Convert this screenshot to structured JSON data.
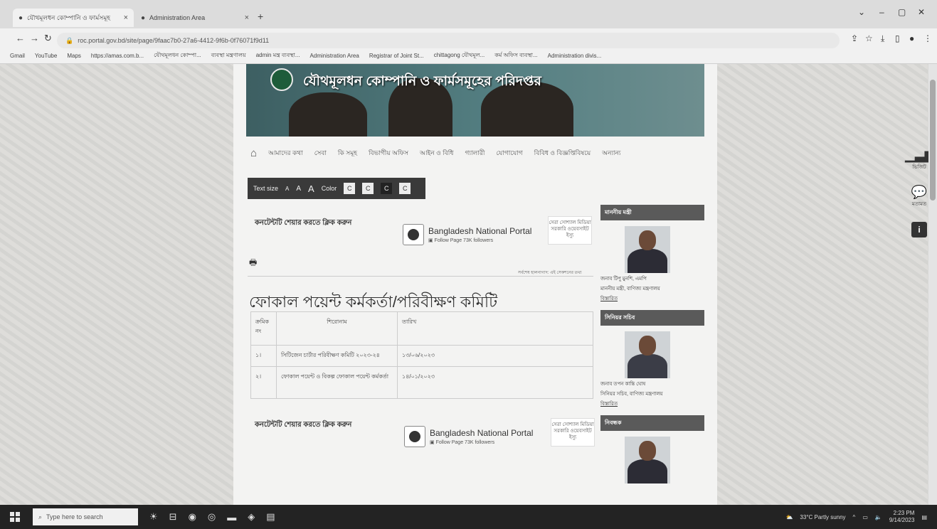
{
  "browser": {
    "tabs": [
      {
        "label": "যৌথমূলধন কোম্পানি ও ফার্মসমূহ",
        "active": true
      },
      {
        "label": "Administration Area",
        "active": false
      }
    ],
    "url": "roc.portal.gov.bd/site/page/9faac7b0-27a6-4412-9f6b-0f76071f9d11",
    "bookmarks": [
      "Gmail",
      "YouTube",
      "Maps",
      "https://amas.com.b...",
      "যৌথমূলধন কোম্পা...",
      "ব্যবস্থা মন্ত্রণালয়",
      "admin মন্ত্র ব্যবস্থা...",
      "Administration Area",
      "Registrar of Joint St...",
      "chittagong যৌথমূল...",
      "কর্ম অফিস ব্যবস্থা...",
      "Administration divis..."
    ]
  },
  "site": {
    "banner_title": "যৌথমূলধন কোম্পানি ও ফার্মসমূহের পরিদপ্তর",
    "nav": [
      "আমাদের কথা",
      "সেবা",
      "কি সমূহ",
      "বিভাগীয় অফিস",
      "আইন ও বিধি",
      "গ্যালারী",
      "যোগাযোগ",
      "বিবিধ ও বিজ্ঞপ্তিবিষয়ে",
      "অন্যান্য"
    ],
    "textsize_label": "Text size",
    "textsize_a": [
      "A",
      "A",
      "A"
    ],
    "color_label": "Color",
    "color_boxes": [
      "C",
      "C",
      "C",
      "C"
    ],
    "share_label": "কনটেন্টটি শেয়ার করতে ক্লিক করুন",
    "portal_name": "Bangladesh National Portal",
    "portal_follow": "Follow Page",
    "portal_followers": "73K followers",
    "portal_card": "সেরা সোশ্যাল মিডিয়া সরকারি ওয়েবসাইট",
    "portal_card_link": "ইস্যু",
    "last_updated": "সর্বশেষ হালনাগাদ: এই সেকশনের তথ্য",
    "heading": "ফোকাল পয়েন্ট কর্মকর্তা/পরিবীক্ষণ কমিটি",
    "table": {
      "headers": [
        "ক্রমিক নং",
        "শিরোনাম",
        "তারিখ"
      ],
      "rows": [
        {
          "no": "১।",
          "title": "সিটিজেন চার্টার পরিবীক্ষণ কমিটি ২০২৩-২৪",
          "date": "১৩/০৬/২০২৩"
        },
        {
          "no": "২।",
          "title": "ফোকাল পয়েন্ট ও বিকল্প ফোকাল পয়েন্ট কর্মকর্তা",
          "date": "১৪/০১/২০২৩"
        }
      ]
    },
    "sidebar": [
      {
        "header": "মাননীয় মন্ত্রী",
        "name": "জনাব টিপু মুনশি, এমপি",
        "role": "মাননীয় মন্ত্রী, বাণিজ্য মন্ত্রণালয়",
        "link": "বিস্তারিত"
      },
      {
        "header": "সিনিয়র সচিব",
        "name": "জনাব তপন কান্তি ঘোষ",
        "role": "সিনিয়র সচিব, বাণিজ্য মন্ত্রণালয়",
        "link": "বিস্তারিত"
      },
      {
        "header": "নিবন্ধক",
        "name": "",
        "role": "",
        "link": ""
      }
    ],
    "float_panel": {
      "stats_label": "ভিজিট",
      "feedback_label": "মতামত"
    }
  },
  "taskbar": {
    "search_placeholder": "Type here to search",
    "weather": "33°C  Partly sunny",
    "time": "2:23 PM",
    "date": "9/14/2023"
  }
}
